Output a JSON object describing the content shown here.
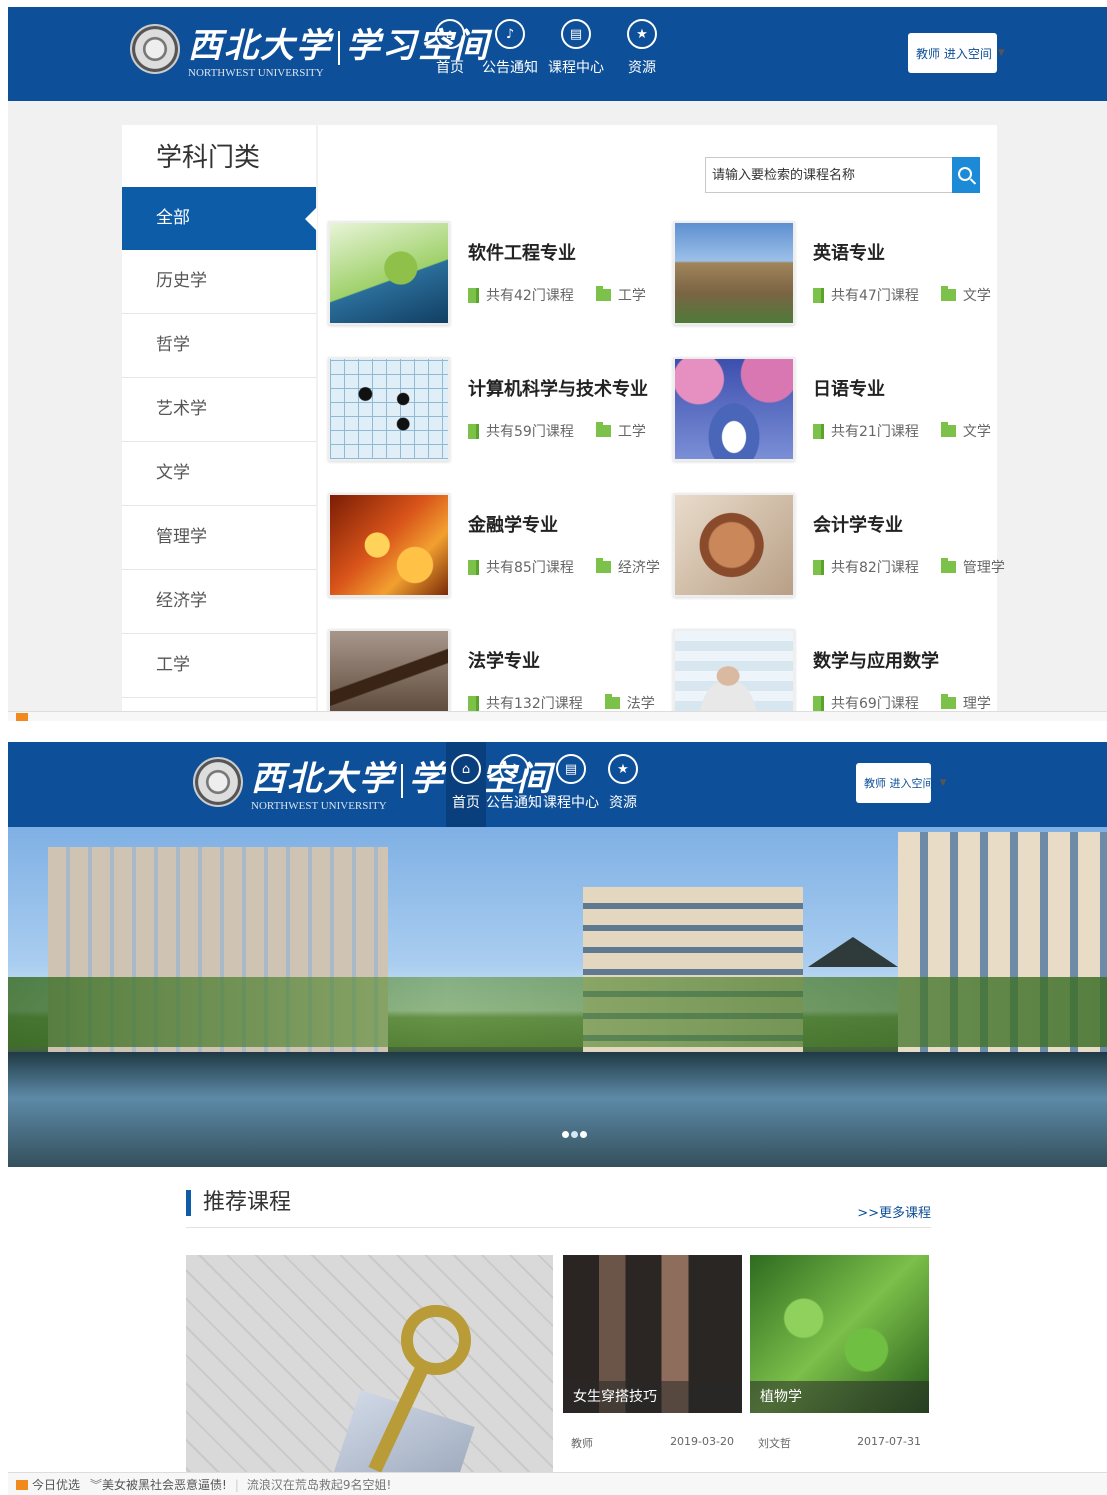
{
  "header": {
    "university_cn": "西北大学",
    "space_cn": "学习空间",
    "university_en": "NORTHWEST UNIVERSITY",
    "nav": [
      {
        "label": "首页",
        "icon": "home-icon"
      },
      {
        "label": "公告通知",
        "icon": "bell-icon"
      },
      {
        "label": "课程中心",
        "icon": "book-icon"
      },
      {
        "label": "资源",
        "icon": "star-icon"
      }
    ],
    "teacher_button": "教师 进入空间"
  },
  "catalog": {
    "sidebar_title": "学科门类",
    "categories": [
      "全部",
      "历史学",
      "哲学",
      "艺术学",
      "文学",
      "管理学",
      "经济学",
      "工学"
    ],
    "search_placeholder": "请输入要检索的课程名称",
    "majors": [
      {
        "name": "软件工程专业",
        "count": "共有42门课程",
        "type": "工学",
        "image": "laptop-globe"
      },
      {
        "name": "英语专业",
        "count": "共有47门课程",
        "type": "文学",
        "image": "oxford-city"
      },
      {
        "name": "计算机科学与技术专业",
        "count": "共有59门课程",
        "type": "工学",
        "image": "go-board"
      },
      {
        "name": "日语专业",
        "count": "共有21门课程",
        "type": "文学",
        "image": "mount-fuji"
      },
      {
        "name": "金融学专业",
        "count": "共有85门课程",
        "type": "经济学",
        "image": "currency-symbols"
      },
      {
        "name": "会计学专业",
        "count": "共有82门课程",
        "type": "管理学",
        "image": "money-globe"
      },
      {
        "name": "法学专业",
        "count": "共有132门课程",
        "type": "法学",
        "image": "gavel"
      },
      {
        "name": "数学与应用数学",
        "count": "共有69门课程",
        "type": "理学",
        "image": "man-formulas"
      }
    ]
  },
  "home": {
    "banner_slides": 3,
    "banner_active": 2,
    "rec_title": "推荐课程",
    "rec_more": ">>更多课程",
    "courses": [
      {
        "title": "女生穿搭技巧",
        "author": "教师",
        "date": "2019-03-20"
      },
      {
        "title": "植物学",
        "author": "刘文哲",
        "date": "2017-07-31"
      }
    ]
  },
  "bottombar": {
    "label": "今日优选",
    "items": [
      "美女被黑社会恶意逼债!",
      "流浪汉在荒岛救起9名空姐!"
    ]
  },
  "colors": {
    "brand_blue": "#0d4f98",
    "active_blue": "#0d5ca8",
    "book_green": "#7cc24a"
  }
}
